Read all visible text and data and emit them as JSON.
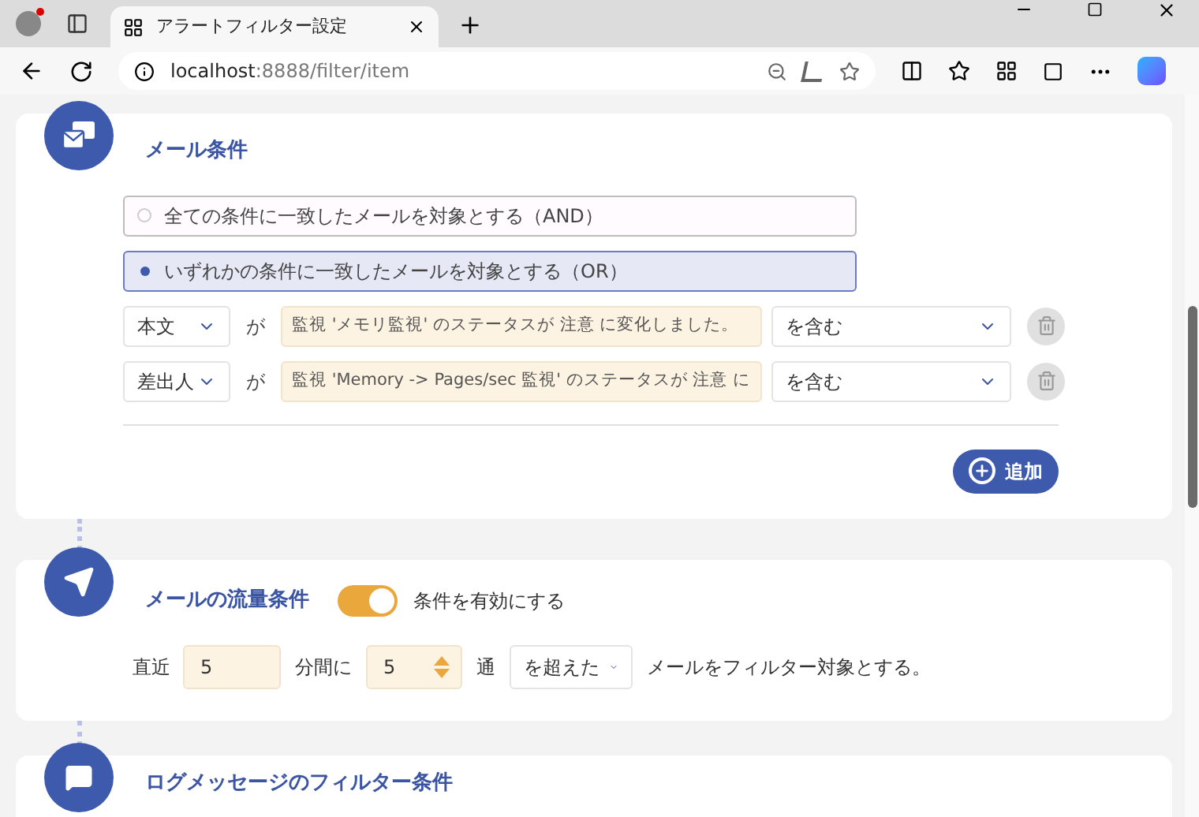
{
  "browser": {
    "tab_title": "アラートフィルター設定",
    "url_host": "localhost",
    "url_path": ":8888/filter/item"
  },
  "mail_conditions": {
    "title": "メール条件",
    "match_modes": [
      {
        "label": "全ての条件に一致したメールを対象とする（AND）",
        "selected": false
      },
      {
        "label": "いずれかの条件に一致したメールを対象とする（OR）",
        "selected": true
      }
    ],
    "rules": [
      {
        "field": "本文",
        "connector": "が",
        "value": "監視 'メモリ監視' のステータスが 注意 に変化しました。",
        "operator": "を含む"
      },
      {
        "field": "差出人",
        "connector": "が",
        "value": "監視 'Memory -> Pages/sec 監視' のステータスが 注意 に",
        "operator": "を含む"
      }
    ],
    "add_button": "追加"
  },
  "flow_conditions": {
    "title": "メールの流量条件",
    "toggle_label": "条件を有効にする",
    "enabled": true,
    "prefix": "直近",
    "minutes": "5",
    "minutes_unit": "分間に",
    "count": "5",
    "count_unit": "通",
    "comparison": "を超えた",
    "suffix": "メールをフィルター対象とする。"
  },
  "log_conditions": {
    "title": "ログメッセージのフィルター条件"
  }
}
